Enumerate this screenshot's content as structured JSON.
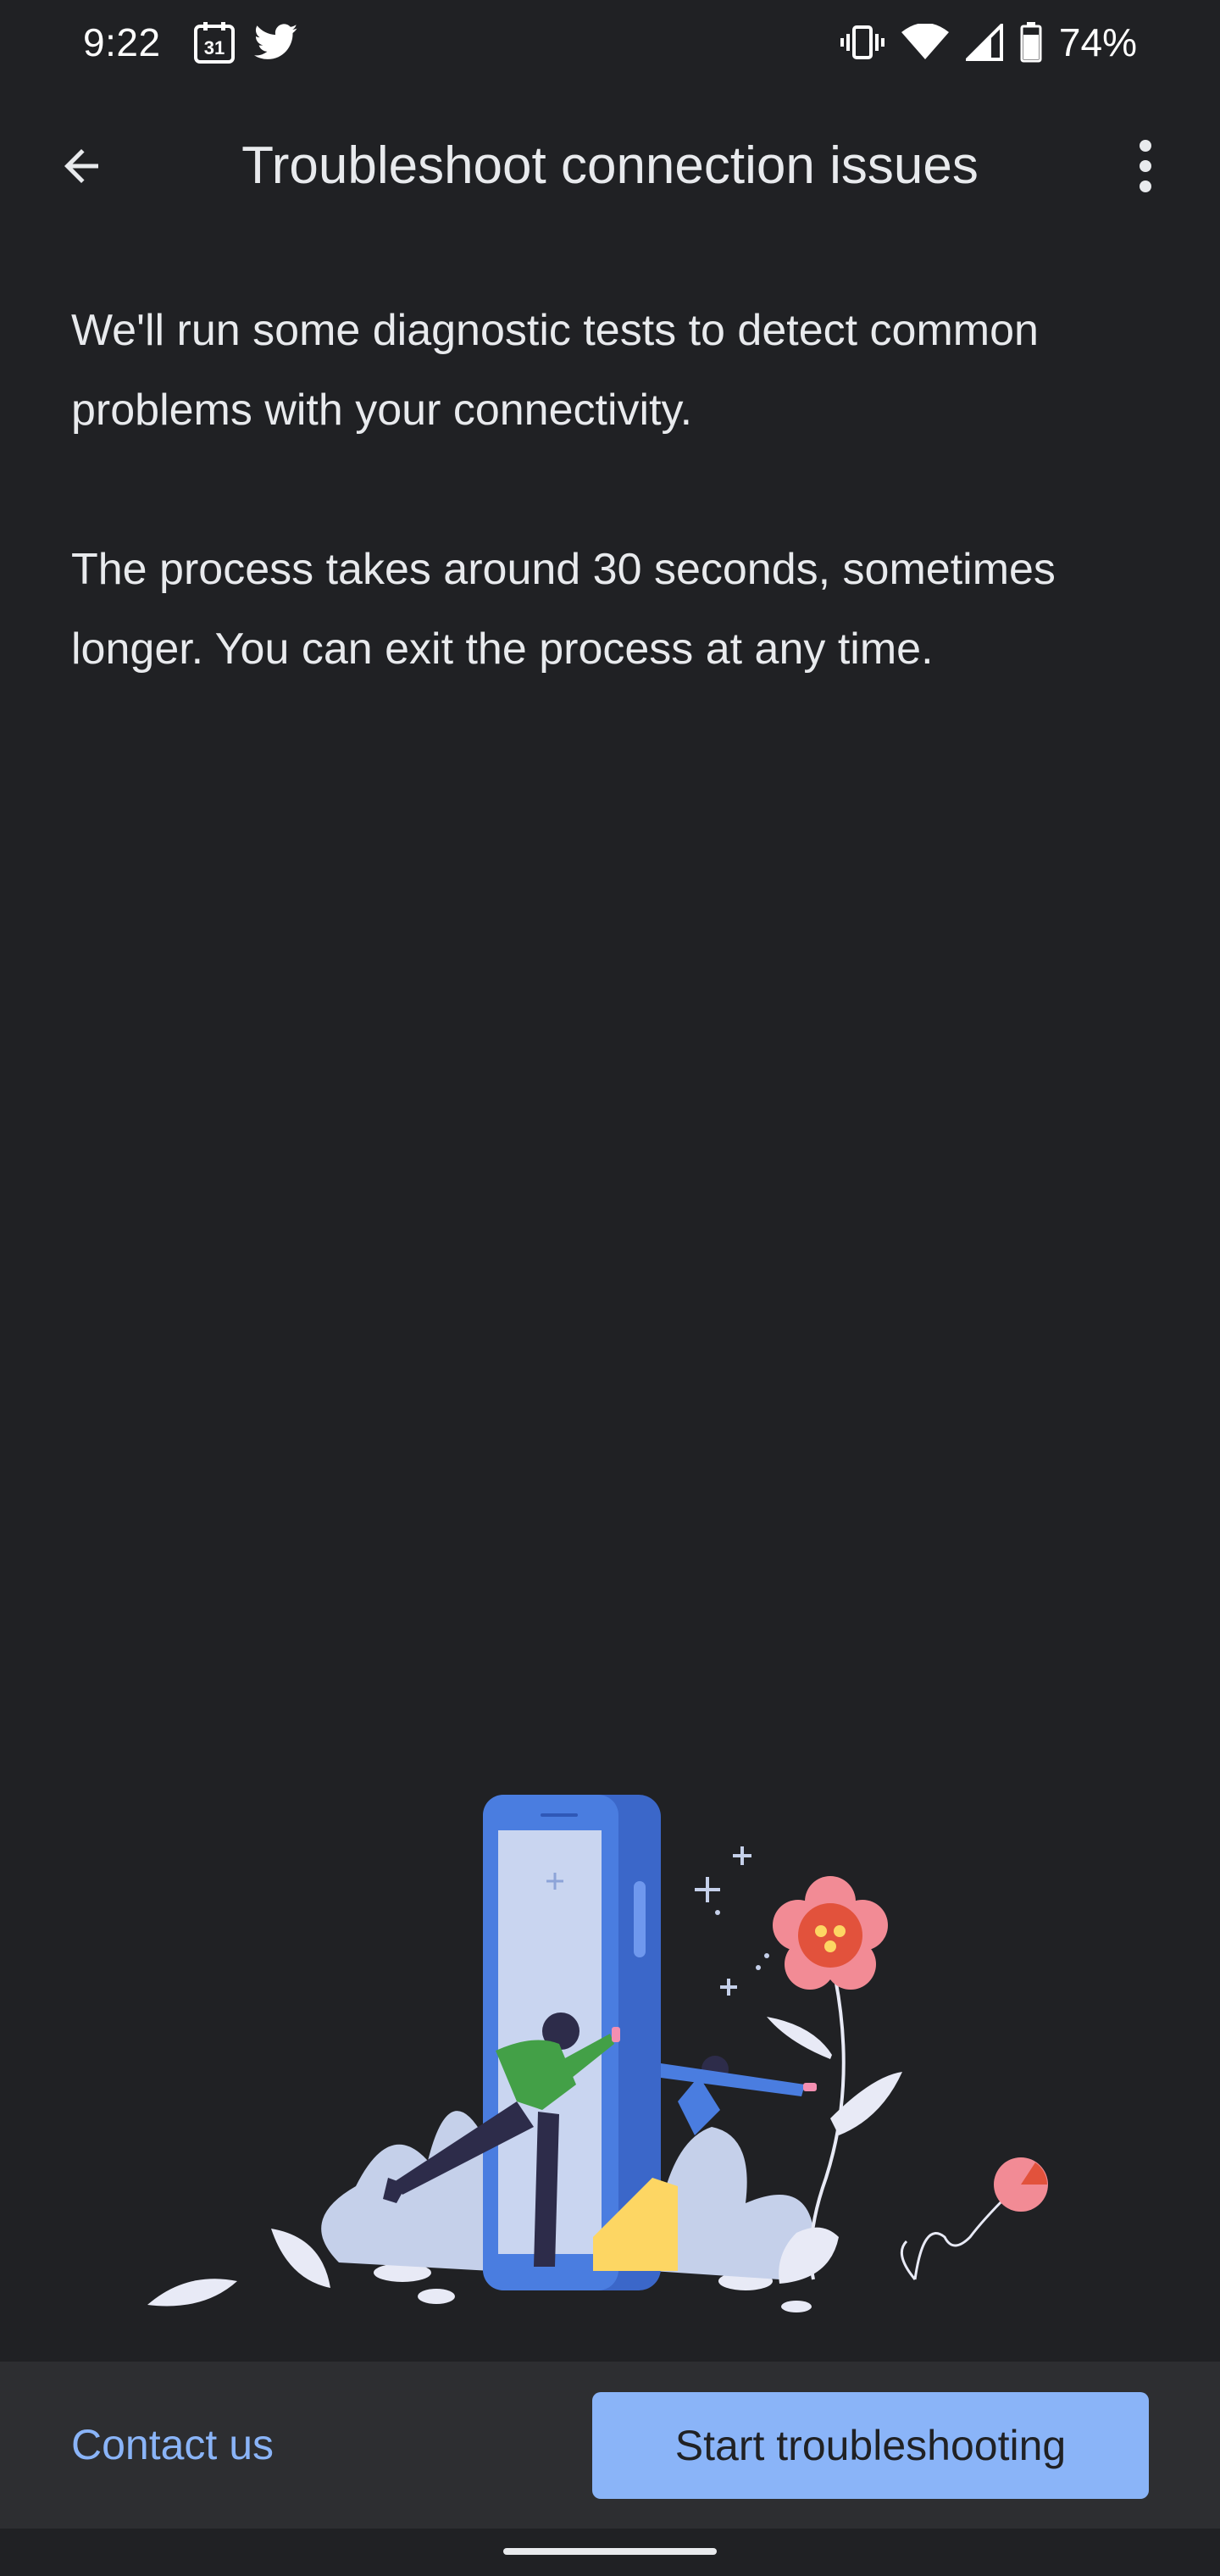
{
  "status_bar": {
    "time": "9:22",
    "calendar_day": "31",
    "battery_percent": "74%",
    "icons": [
      "calendar-icon",
      "twitter-icon",
      "vibrate-icon",
      "wifi-icon",
      "cell-signal-icon",
      "battery-icon"
    ]
  },
  "app_bar": {
    "title": "Troubleshoot connection issues",
    "back_icon": "arrow-back-icon",
    "overflow_icon": "more-vert-icon"
  },
  "content": {
    "paragraph_1": "We'll run some diagnostic tests to detect common problems with your connectivity.",
    "paragraph_2": "The process takes around 30 seconds, sometimes longer. You can exit the process at any time."
  },
  "footer": {
    "contact_label": "Contact us",
    "start_label": "Start troubleshooting"
  },
  "colors": {
    "background": "#202124",
    "footer_background": "#2d2e31",
    "accent": "#8ab4f8",
    "text_primary": "#e8eaed"
  }
}
